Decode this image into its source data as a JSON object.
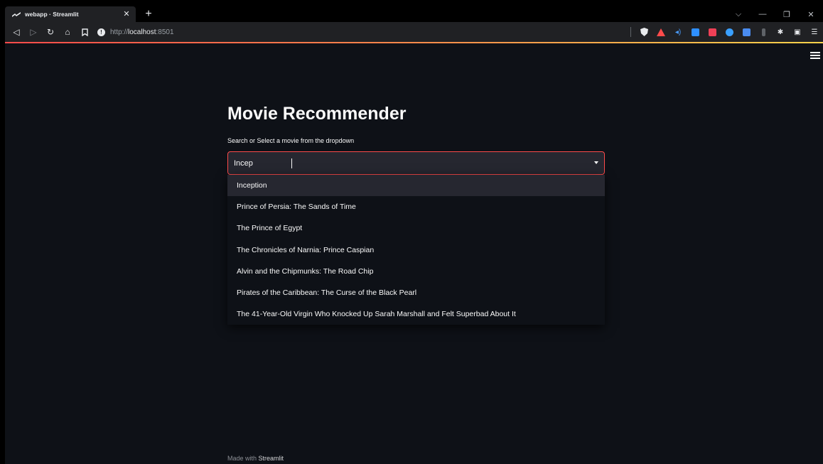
{
  "browser": {
    "tab_title": "webapp · Streamlit",
    "tab_close": "✕",
    "new_tab": "+",
    "url_protocol": "http://",
    "url_host": "localhost",
    "url_port": ":8501"
  },
  "app": {
    "title": "Movie Recommender",
    "select_label": "Search or Select a movie from the dropdown",
    "search_value": "Incep",
    "options": [
      "Inception",
      "Prince of Persia: The Sands of Time",
      "The Prince of Egypt",
      "The Chronicles of Narnia: Prince Caspian",
      "Alvin and the Chipmunks: The Road Chip",
      "Pirates of the Caribbean: The Curse of the Black Pearl",
      "The 41-Year-Old Virgin Who Knocked Up Sarah Marshall and Felt Superbad About It"
    ],
    "footer_prefix": "Made with",
    "footer_brand": "Streamlit"
  },
  "colors": {
    "background": "#0e1117",
    "accent": "#ff4b4b",
    "input_bg": "#262730"
  }
}
